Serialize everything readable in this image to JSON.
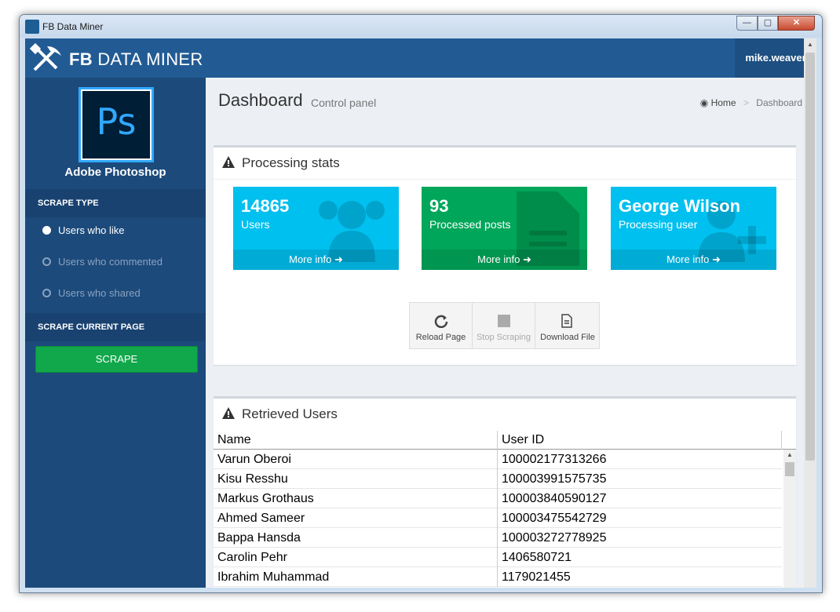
{
  "window": {
    "title": "FB Data Miner",
    "min": "—",
    "max": "▢",
    "close": "✕"
  },
  "header": {
    "brand_bold": "FB",
    "brand_rest": " DATA MINER",
    "user": "mike.weaver"
  },
  "sidebar": {
    "app_logo_text": "Ps",
    "app_name": "Adobe Photoshop",
    "scrape_type_label": "SCRAPE TYPE",
    "options": [
      {
        "label": "Users who like",
        "selected": true
      },
      {
        "label": "Users who commented",
        "selected": false
      },
      {
        "label": "Users who shared",
        "selected": false
      }
    ],
    "scrape_current_label": "SCRAPE CURRENT PAGE",
    "scrape_button": "SCRAPE"
  },
  "page": {
    "title": "Dashboard",
    "subtitle": "Control panel",
    "breadcrumb": {
      "home": "Home",
      "separator": ">",
      "current": "Dashboard"
    }
  },
  "stats_box": {
    "title": "Processing stats",
    "tiles": [
      {
        "value": "14865",
        "label": "Users",
        "footer": "More info",
        "color": "#00c0ef"
      },
      {
        "value": "93",
        "label": "Processed posts",
        "footer": "More info",
        "color": "#00a65a"
      },
      {
        "value": "George Wilson",
        "label": "Processing user",
        "footer": "More info",
        "color": "#00c0ef"
      }
    ],
    "controls": [
      {
        "label": "Reload Page",
        "enabled": true
      },
      {
        "label": "Stop Scraping",
        "enabled": false
      },
      {
        "label": "Download File",
        "enabled": true
      }
    ]
  },
  "users_box": {
    "title": "Retrieved Users",
    "columns": [
      "Name",
      "User ID"
    ],
    "rows": [
      [
        "Varun Oberoi",
        "100002177313266"
      ],
      [
        "Kisu Resshu",
        "100003991575735"
      ],
      [
        "Markus Grothaus",
        "100003840590127"
      ],
      [
        "Ahmed Sameer",
        "100003475542729"
      ],
      [
        "Bappa Hansda",
        "100003272778925"
      ],
      [
        "Carolin Pehr",
        "1406580721"
      ],
      [
        "Ibrahim Muhammad",
        "1179021455"
      ]
    ]
  }
}
